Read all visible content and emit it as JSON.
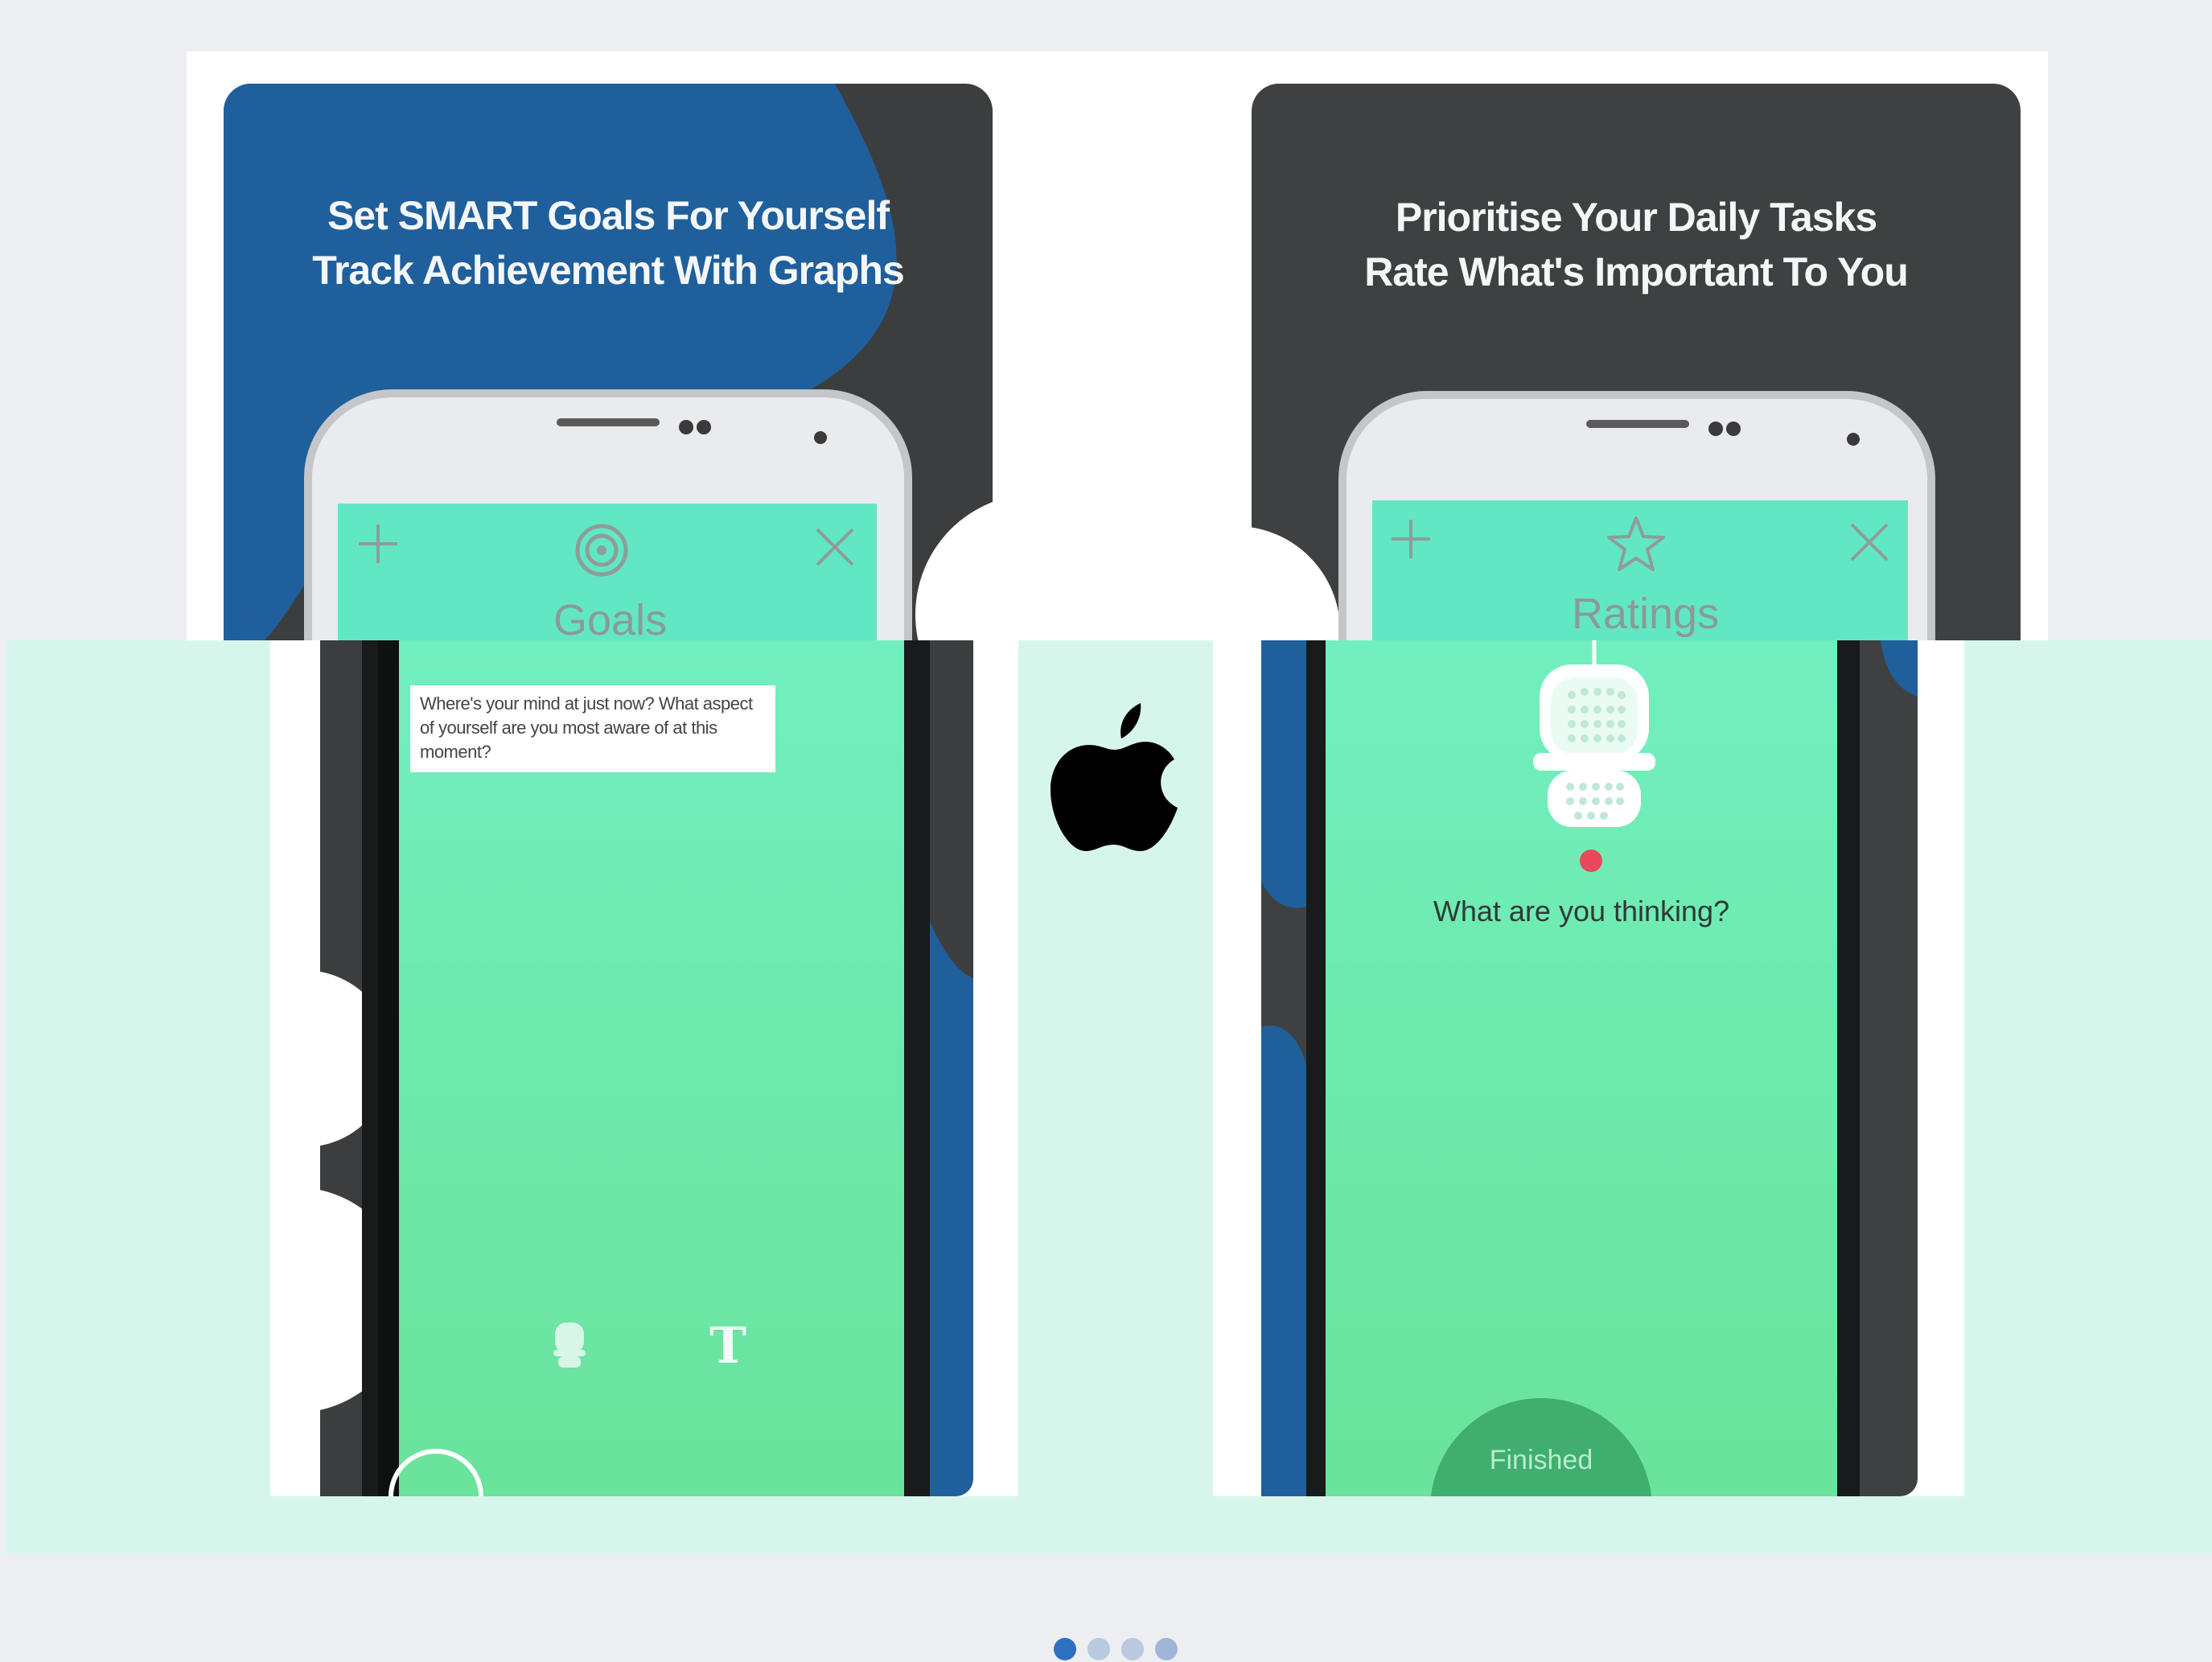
{
  "left_card": {
    "headline_line1": "Set SMART Goals For Yourself",
    "headline_line2": "Track Achievement With Graphs",
    "bar_title": "Goals",
    "bar_plus_icon": "plus-icon",
    "bar_goal_icon": "target-icon",
    "bar_close_icon": "close-icon",
    "prompt_text": "Where's your mind at just now? What aspect of yourself are you most aware of at this moment?",
    "mic_icon": "microphone-icon",
    "text_icon_glyph": "T"
  },
  "right_card": {
    "headline_line1": "Prioritise Your Daily Tasks",
    "headline_line2": "Rate What's Important To You",
    "bar_title": "Ratings",
    "bar_plus_icon": "plus-icon",
    "bar_star_icon": "star-icon",
    "bar_close_icon": "close-icon",
    "mic_icon": "microphone-icon",
    "question_text": "What are you thinking?",
    "finished_label": "Finished"
  },
  "center": {
    "logo_icon": "apple-logo-icon"
  },
  "pagination": {
    "count": 4,
    "active_index": 0
  },
  "colors": {
    "page_bg": "#eceef2",
    "mint_bg": "#d6f6ec",
    "card_dark": "#3c3d3f",
    "card_blue": "#1f5f9c",
    "app_mint": "#62e7c4",
    "screen_green": "#6ee7a8",
    "dot_active": "#2f6fc0",
    "dot_inactive": "#b8c9e0"
  }
}
